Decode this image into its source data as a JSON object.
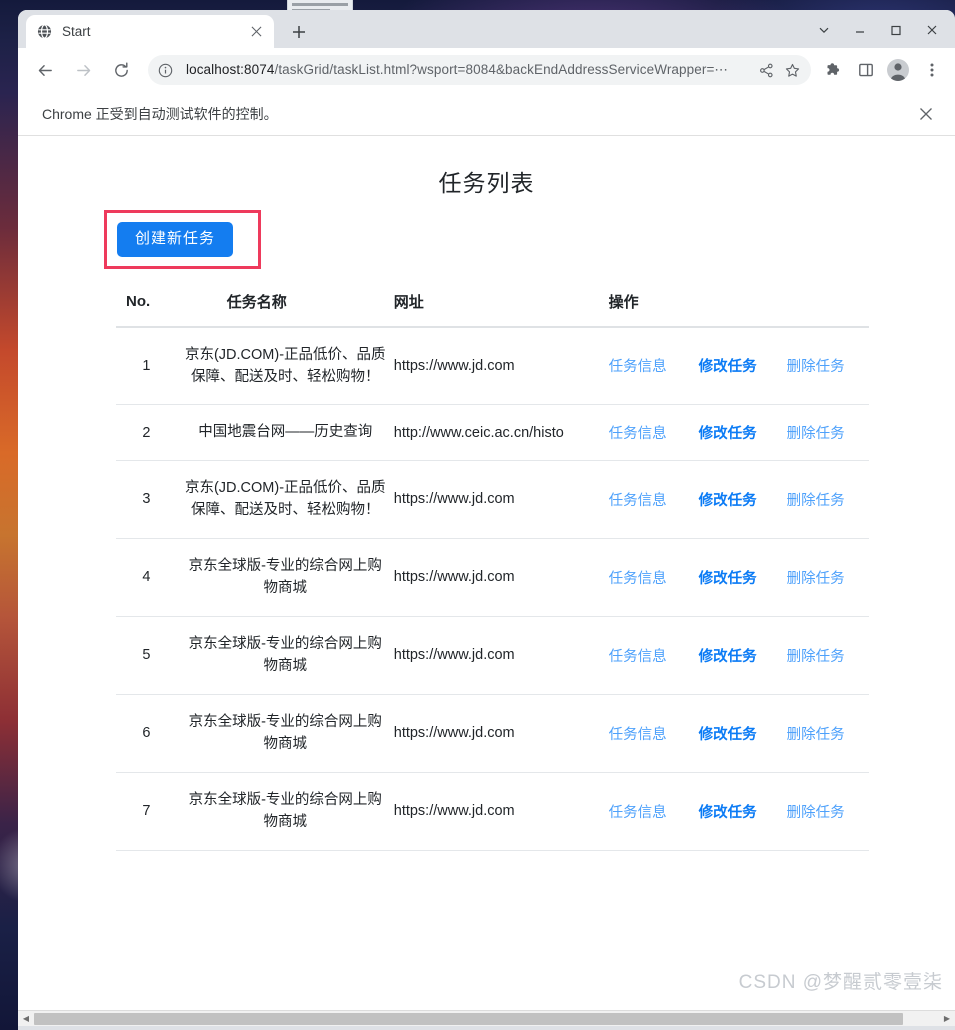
{
  "browser": {
    "tab": {
      "title": "Start",
      "favicon": "globe-icon",
      "close_label": "×"
    },
    "new_tab_label": "+",
    "window_controls": [
      {
        "name": "chevron-down",
        "glyph": "⌄"
      },
      {
        "name": "minimize",
        "glyph": "–"
      },
      {
        "name": "maximize",
        "glyph": "□"
      },
      {
        "name": "close",
        "glyph": "✕"
      }
    ],
    "toolbar": {
      "back": "back-arrow-icon",
      "forward": "forward-arrow-icon",
      "reload": "reload-icon",
      "site_info": "info-circle-icon",
      "url_host": "localhost:8074",
      "url_path": "/taskGrid/taskList.html?wsport=8084&backEndAddressServiceWrapper=⋯",
      "url_full": "localhost:8074/taskGrid/taskList.html?wsport=8084&backEndAddressServiceWrapper=⋯",
      "share": "share-icon",
      "bookmark": "star-icon",
      "extensions": "puzzle-icon",
      "side_panel": "side-panel-icon",
      "profile": "profile-avatar-icon",
      "menu": "three-dot-menu-icon"
    },
    "infobar": {
      "message": "Chrome 正受到自动测试软件的控制。",
      "close": "✕"
    }
  },
  "page": {
    "title": "任务列表",
    "create_button": "创建新任务",
    "highlight_color": "#ee3a5c",
    "accent_color": "#147df0",
    "table": {
      "headers": {
        "no": "No.",
        "name": "任务名称",
        "url": "网址",
        "op": "操作"
      },
      "actions": {
        "info": "任务信息",
        "edit": "修改任务",
        "delete": "删除任务"
      },
      "rows": [
        {
          "no": "1",
          "name": "京东(JD.COM)-正品低价、品质保障、配送及时、轻松购物！",
          "url": "https://www.jd.com"
        },
        {
          "no": "2",
          "name": "中国地震台网——历史查询",
          "url": "http://www.ceic.ac.cn/histo"
        },
        {
          "no": "3",
          "name": "京东(JD.COM)-正品低价、品质保障、配送及时、轻松购物！",
          "url": "https://www.jd.com"
        },
        {
          "no": "4",
          "name": "京东全球版-专业的综合网上购物商城",
          "url": "https://www.jd.com"
        },
        {
          "no": "5",
          "name": "京东全球版-专业的综合网上购物商城",
          "url": "https://www.jd.com"
        },
        {
          "no": "6",
          "name": "京东全球版-专业的综合网上购物商城",
          "url": "https://www.jd.com"
        },
        {
          "no": "7",
          "name": "京东全球版-专业的综合网上购物商城",
          "url": "https://www.jd.com"
        }
      ]
    },
    "watermark": "CSDN @梦醒贰零壹柒"
  }
}
